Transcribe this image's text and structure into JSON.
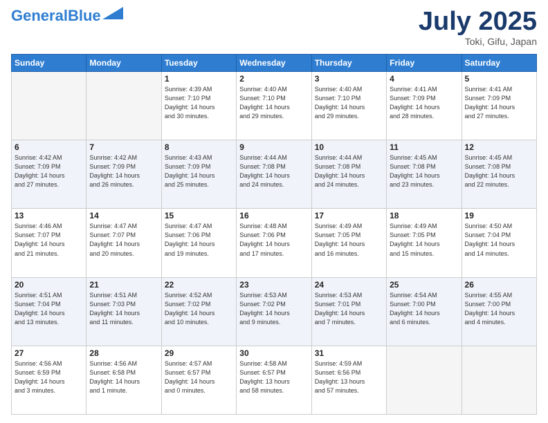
{
  "header": {
    "logo_line1": "General",
    "logo_line2": "Blue",
    "title": "July 2025",
    "location": "Toki, Gifu, Japan"
  },
  "days_of_week": [
    "Sunday",
    "Monday",
    "Tuesday",
    "Wednesday",
    "Thursday",
    "Friday",
    "Saturday"
  ],
  "weeks": [
    [
      {
        "day": "",
        "info": ""
      },
      {
        "day": "",
        "info": ""
      },
      {
        "day": "1",
        "info": "Sunrise: 4:39 AM\nSunset: 7:10 PM\nDaylight: 14 hours\nand 30 minutes."
      },
      {
        "day": "2",
        "info": "Sunrise: 4:40 AM\nSunset: 7:10 PM\nDaylight: 14 hours\nand 29 minutes."
      },
      {
        "day": "3",
        "info": "Sunrise: 4:40 AM\nSunset: 7:10 PM\nDaylight: 14 hours\nand 29 minutes."
      },
      {
        "day": "4",
        "info": "Sunrise: 4:41 AM\nSunset: 7:09 PM\nDaylight: 14 hours\nand 28 minutes."
      },
      {
        "day": "5",
        "info": "Sunrise: 4:41 AM\nSunset: 7:09 PM\nDaylight: 14 hours\nand 27 minutes."
      }
    ],
    [
      {
        "day": "6",
        "info": "Sunrise: 4:42 AM\nSunset: 7:09 PM\nDaylight: 14 hours\nand 27 minutes."
      },
      {
        "day": "7",
        "info": "Sunrise: 4:42 AM\nSunset: 7:09 PM\nDaylight: 14 hours\nand 26 minutes."
      },
      {
        "day": "8",
        "info": "Sunrise: 4:43 AM\nSunset: 7:09 PM\nDaylight: 14 hours\nand 25 minutes."
      },
      {
        "day": "9",
        "info": "Sunrise: 4:44 AM\nSunset: 7:08 PM\nDaylight: 14 hours\nand 24 minutes."
      },
      {
        "day": "10",
        "info": "Sunrise: 4:44 AM\nSunset: 7:08 PM\nDaylight: 14 hours\nand 24 minutes."
      },
      {
        "day": "11",
        "info": "Sunrise: 4:45 AM\nSunset: 7:08 PM\nDaylight: 14 hours\nand 23 minutes."
      },
      {
        "day": "12",
        "info": "Sunrise: 4:45 AM\nSunset: 7:08 PM\nDaylight: 14 hours\nand 22 minutes."
      }
    ],
    [
      {
        "day": "13",
        "info": "Sunrise: 4:46 AM\nSunset: 7:07 PM\nDaylight: 14 hours\nand 21 minutes."
      },
      {
        "day": "14",
        "info": "Sunrise: 4:47 AM\nSunset: 7:07 PM\nDaylight: 14 hours\nand 20 minutes."
      },
      {
        "day": "15",
        "info": "Sunrise: 4:47 AM\nSunset: 7:06 PM\nDaylight: 14 hours\nand 19 minutes."
      },
      {
        "day": "16",
        "info": "Sunrise: 4:48 AM\nSunset: 7:06 PM\nDaylight: 14 hours\nand 17 minutes."
      },
      {
        "day": "17",
        "info": "Sunrise: 4:49 AM\nSunset: 7:05 PM\nDaylight: 14 hours\nand 16 minutes."
      },
      {
        "day": "18",
        "info": "Sunrise: 4:49 AM\nSunset: 7:05 PM\nDaylight: 14 hours\nand 15 minutes."
      },
      {
        "day": "19",
        "info": "Sunrise: 4:50 AM\nSunset: 7:04 PM\nDaylight: 14 hours\nand 14 minutes."
      }
    ],
    [
      {
        "day": "20",
        "info": "Sunrise: 4:51 AM\nSunset: 7:04 PM\nDaylight: 14 hours\nand 13 minutes."
      },
      {
        "day": "21",
        "info": "Sunrise: 4:51 AM\nSunset: 7:03 PM\nDaylight: 14 hours\nand 11 minutes."
      },
      {
        "day": "22",
        "info": "Sunrise: 4:52 AM\nSunset: 7:02 PM\nDaylight: 14 hours\nand 10 minutes."
      },
      {
        "day": "23",
        "info": "Sunrise: 4:53 AM\nSunset: 7:02 PM\nDaylight: 14 hours\nand 9 minutes."
      },
      {
        "day": "24",
        "info": "Sunrise: 4:53 AM\nSunset: 7:01 PM\nDaylight: 14 hours\nand 7 minutes."
      },
      {
        "day": "25",
        "info": "Sunrise: 4:54 AM\nSunset: 7:00 PM\nDaylight: 14 hours\nand 6 minutes."
      },
      {
        "day": "26",
        "info": "Sunrise: 4:55 AM\nSunset: 7:00 PM\nDaylight: 14 hours\nand 4 minutes."
      }
    ],
    [
      {
        "day": "27",
        "info": "Sunrise: 4:56 AM\nSunset: 6:59 PM\nDaylight: 14 hours\nand 3 minutes."
      },
      {
        "day": "28",
        "info": "Sunrise: 4:56 AM\nSunset: 6:58 PM\nDaylight: 14 hours\nand 1 minute."
      },
      {
        "day": "29",
        "info": "Sunrise: 4:57 AM\nSunset: 6:57 PM\nDaylight: 14 hours\nand 0 minutes."
      },
      {
        "day": "30",
        "info": "Sunrise: 4:58 AM\nSunset: 6:57 PM\nDaylight: 13 hours\nand 58 minutes."
      },
      {
        "day": "31",
        "info": "Sunrise: 4:59 AM\nSunset: 6:56 PM\nDaylight: 13 hours\nand 57 minutes."
      },
      {
        "day": "",
        "info": ""
      },
      {
        "day": "",
        "info": ""
      }
    ]
  ]
}
